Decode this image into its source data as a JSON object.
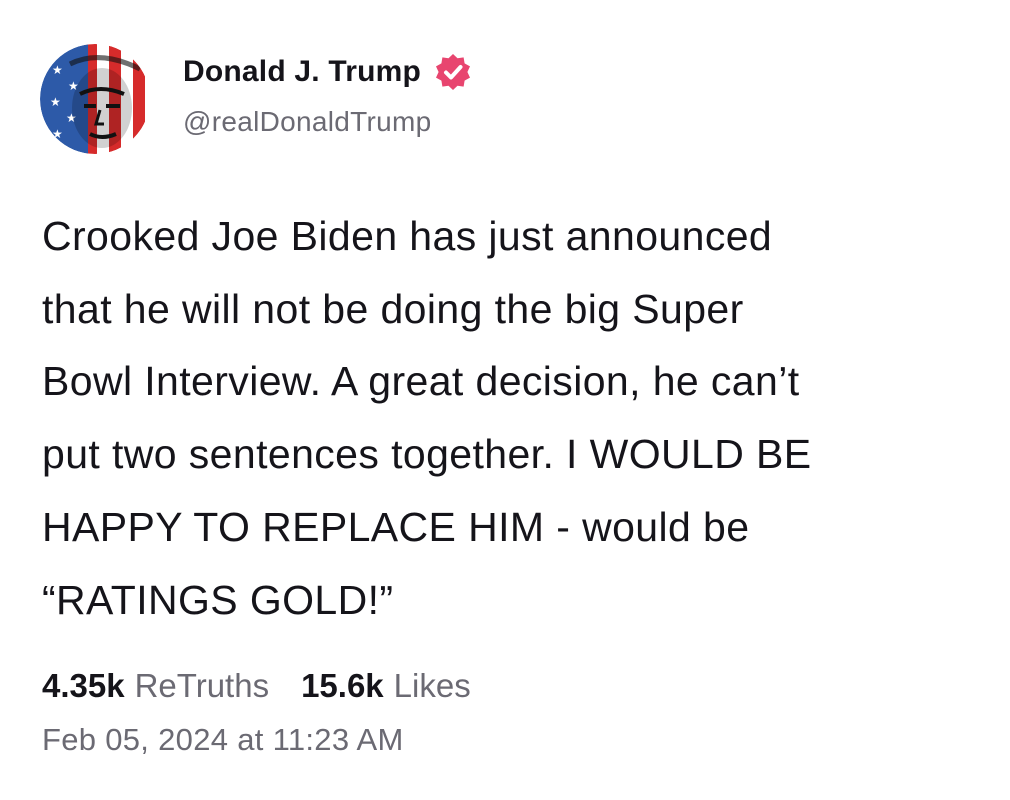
{
  "author": {
    "display_name": "Donald J. Trump",
    "handle": "@realDonaldTrump",
    "verified": true,
    "avatar_icon": "flag-portrait-avatar",
    "verified_icon": "verified-badge-icon",
    "verified_color": "#e8456f"
  },
  "post": {
    "lines": [
      "Crooked Joe Biden has just announced",
      "that he will not be doing the big Super",
      "Bowl Interview. A great decision, he can’t",
      "put two sentences together. I WOULD BE",
      "HAPPY TO REPLACE HIM - would be",
      "“RATINGS GOLD!”"
    ]
  },
  "stats": {
    "retruths_count": "4.35k",
    "retruths_label": "ReTruths",
    "likes_count": "15.6k",
    "likes_label": "Likes"
  },
  "timestamp": "Feb 05, 2024 at 11:23 AM"
}
